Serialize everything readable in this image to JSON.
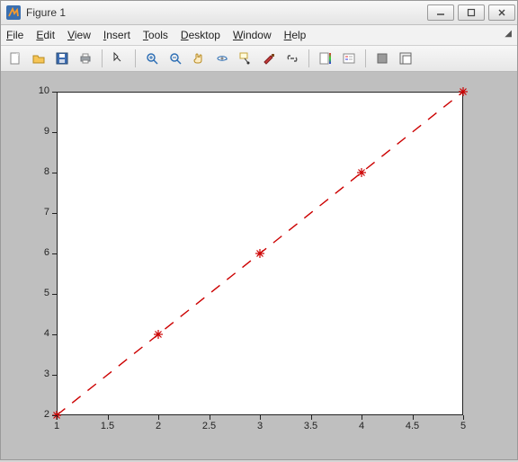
{
  "window": {
    "title": "Figure 1"
  },
  "menubar": {
    "items": [
      "File",
      "Edit",
      "View",
      "Insert",
      "Tools",
      "Desktop",
      "Window",
      "Help"
    ]
  },
  "toolbar": {
    "items": [
      "new-figure",
      "open-file",
      "save-figure",
      "print-figure",
      "sep",
      "edit-plot",
      "sep",
      "zoom-in",
      "zoom-out",
      "pan",
      "rotate-3d",
      "data-cursor",
      "brush",
      "link-plots",
      "sep",
      "insert-colorbar",
      "insert-legend",
      "sep",
      "hide-plot-tools",
      "show-plot-tools"
    ]
  },
  "chart_data": {
    "type": "line",
    "x": [
      1,
      2,
      3,
      4,
      5
    ],
    "y": [
      2,
      4,
      6,
      8,
      10
    ],
    "xlim": [
      1,
      5
    ],
    "ylim": [
      2,
      10
    ],
    "xticks": [
      1,
      1.5,
      2,
      2.5,
      3,
      3.5,
      4,
      4.5,
      5
    ],
    "yticks": [
      2,
      3,
      4,
      5,
      6,
      7,
      8,
      9,
      10
    ],
    "line_style": "dashed",
    "marker": "*",
    "color": "#cc0000",
    "title": "",
    "xlabel": "",
    "ylabel": ""
  }
}
